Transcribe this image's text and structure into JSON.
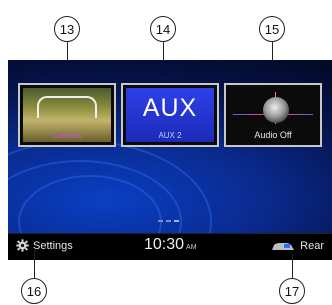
{
  "callouts": {
    "c13": "13",
    "c14": "14",
    "c15": "15",
    "c16": "16",
    "c17": "17"
  },
  "tiles": {
    "camera": {
      "label": "Camera"
    },
    "aux": {
      "big": "AUX",
      "small": "AUX 2"
    },
    "audio": {
      "label": "Audio Off"
    }
  },
  "statusbar": {
    "settings_label": "Settings",
    "time": "10:30",
    "ampm": "AM",
    "rear_label": "Rear"
  },
  "page_indicator": {
    "pages": 3,
    "active": 3
  },
  "colors": {
    "camera_label": "#c457d0",
    "aux_tile": "#2230d8",
    "screen_bg": "#0a2a8e"
  }
}
